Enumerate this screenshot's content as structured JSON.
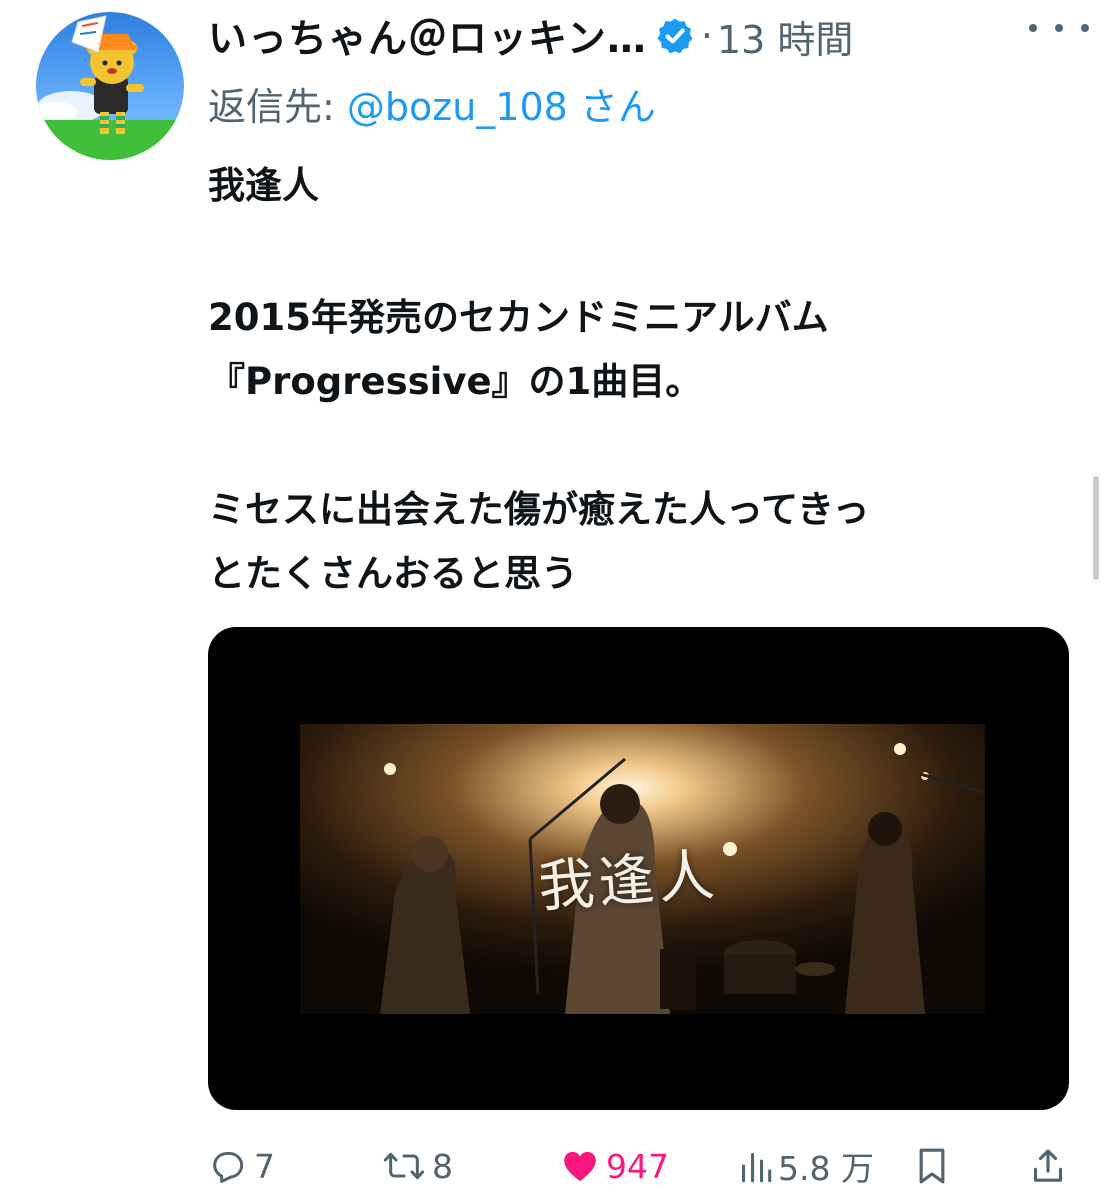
{
  "tweet": {
    "display_name": "いっちゃん＠ロッキン…",
    "dot": "·",
    "time": "13 時間",
    "reply_prefix": "返信先: ",
    "reply_handle": "@bozu_108",
    "reply_suffix": " さん",
    "text_lines": [
      "我逢人",
      "2015年発売のセカンドミニアルバム",
      "『Progressive』の1曲目。",
      "ミセスに出会えた傷が癒えた人ってきっ",
      "とたくさんおると思う"
    ],
    "media_caption": "我逢人"
  },
  "actions": {
    "reply_count": "7",
    "retweet_count": "8",
    "like_count": "947",
    "views_count": "5.8 万"
  },
  "icons": {
    "avatar": "bear-avatar-icon",
    "verified": "verified-badge-icon",
    "more": "more-dots-icon",
    "reply": "reply-bubble-icon",
    "retweet": "retweet-icon",
    "like": "heart-icon",
    "views": "views-chart-icon",
    "bookmark": "bookmark-icon",
    "share": "share-icon"
  },
  "colors": {
    "link": "#1d9bf0",
    "like": "#f91880",
    "muted": "#536471",
    "text": "#0f1419"
  }
}
